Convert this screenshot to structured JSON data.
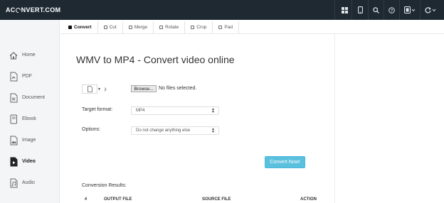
{
  "header": {
    "logo_left": "AC",
    "logo_right": "NVERT.COM",
    "icons": [
      "grid-icon",
      "mobile-icon",
      "search-icon",
      "help-icon",
      "language-icon",
      "refresh-icon"
    ]
  },
  "sidebar": {
    "items": [
      {
        "label": "Home",
        "icon": "home-icon",
        "active": false
      },
      {
        "label": "PDF",
        "icon": "pdf-icon",
        "active": false
      },
      {
        "label": "Document",
        "icon": "document-icon",
        "active": false
      },
      {
        "label": "Ebook",
        "icon": "ebook-icon",
        "active": false
      },
      {
        "label": "Image",
        "icon": "image-icon",
        "active": false
      },
      {
        "label": "Video",
        "icon": "video-icon",
        "active": true
      },
      {
        "label": "Audio",
        "icon": "audio-icon",
        "active": false
      }
    ]
  },
  "tabs": [
    {
      "label": "Convert",
      "active": true
    },
    {
      "label": "Cut",
      "active": false
    },
    {
      "label": "Merge",
      "active": false
    },
    {
      "label": "Rotate",
      "active": false
    },
    {
      "label": "Crop",
      "active": false
    },
    {
      "label": "Pad",
      "active": false
    }
  ],
  "main": {
    "title": "WMV to MP4 - Convert video online",
    "browse_label": "Browse...",
    "file_status": "No files selected.",
    "target_format_label": "Target format:",
    "target_format_value": "MP4",
    "options_label": "Options:",
    "options_value": "Do not change anything else",
    "convert_button": "Convert Now!",
    "results_label": "Conversion Results:",
    "table_headers": [
      "#",
      "OUTPUT FILE",
      "SOURCE FILE",
      "ACTION"
    ]
  },
  "colors": {
    "topbar": "#1e2932",
    "accent": "#5bc0de",
    "sidebar_bg": "#f4f5f6"
  }
}
